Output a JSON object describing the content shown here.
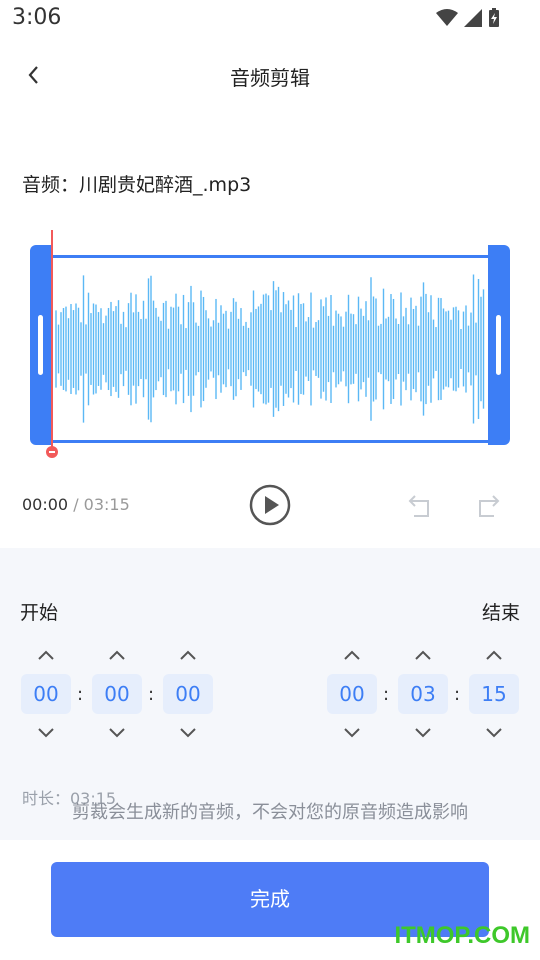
{
  "status_bar": {
    "time": "3:06"
  },
  "header": {
    "title": "音频剪辑"
  },
  "file": {
    "label": "音频：",
    "name": "川剧贵妃醉酒_.mp3"
  },
  "playback": {
    "current": "00:00",
    "separator": " / ",
    "total": "03:15"
  },
  "range": {
    "start_label": "开始",
    "end_label": "结束",
    "start": [
      "00",
      "00",
      "00"
    ],
    "end": [
      "00",
      "03",
      "15"
    ],
    "colon": ":"
  },
  "duration": "时长：03:15",
  "notice": "剪裁会生成新的音频，不会对您的原音频造成影响",
  "done_button": "完成",
  "watermark": "ITMOP.COM",
  "colors": {
    "accent": "#3d7ef5",
    "playhead": "#f25a5a",
    "wave": "#5bb8f5",
    "button": "#4e7cf6"
  }
}
